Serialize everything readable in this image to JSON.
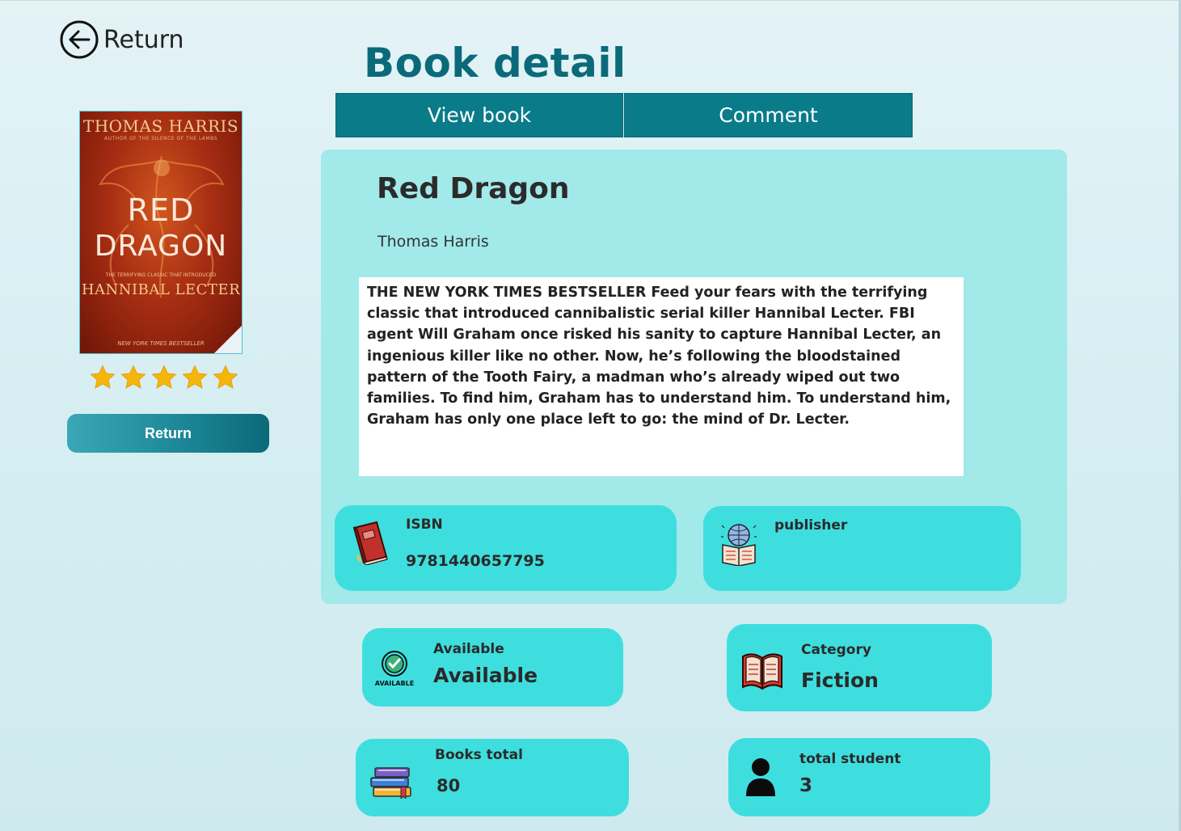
{
  "header": {
    "back_label": "Return",
    "page_title": "Book detail"
  },
  "tabs": [
    {
      "label": "View book"
    },
    {
      "label": "Comment"
    }
  ],
  "sidebar": {
    "cover": {
      "author": "THOMAS HARRIS",
      "tagline": "AUTHOR OF THE SILENCE OF THE LAMBS",
      "title_line1": "RED",
      "title_line2": "DRAGON",
      "tagline2": "THE TERRIFYING CLASSIC THAT INTRODUCED",
      "subtitle": "HANNIBAL LECTER",
      "footer": "NEW YORK TIMES BESTSELLER"
    },
    "rating": {
      "stars": 5,
      "max": 5,
      "color": "#f5b50a"
    },
    "return_button_label": "Return"
  },
  "book": {
    "title": "Red Dragon",
    "author": "Thomas Harris",
    "description": "THE NEW YORK TIMES BESTSELLER Feed your fears with the terrifying classic that introduced cannibalistic serial killer Hannibal Lecter. FBI agent Will Graham once risked his sanity to capture Hannibal Lecter, an ingenious killer like no other. Now, he’s following the bloodstained pattern of the Tooth Fairy, a madman who’s already wiped out two families. To find him, Graham has to understand him. To understand him, Graham has only one place left to go: the mind of Dr. Lecter."
  },
  "info_cards": {
    "isbn": {
      "label": "ISBN",
      "value": "9781440657795",
      "icon": "red-book-icon"
    },
    "publisher": {
      "label": "publisher",
      "value": "",
      "icon": "globe-book-icon"
    },
    "available": {
      "label": "Available",
      "value": "Available",
      "icon": "available-badge-icon"
    },
    "category": {
      "label": "Category",
      "value": "Fiction",
      "icon": "open-book-icon"
    },
    "books_total": {
      "label": "Books total",
      "value": "80",
      "icon": "book-stack-icon"
    },
    "total_student": {
      "label": "total student",
      "value": "3",
      "icon": "person-icon"
    }
  },
  "colors": {
    "accent": "#0a7b89",
    "title": "#0b6a7a",
    "panel": "#a2e9ea",
    "card": "#3fdede"
  }
}
